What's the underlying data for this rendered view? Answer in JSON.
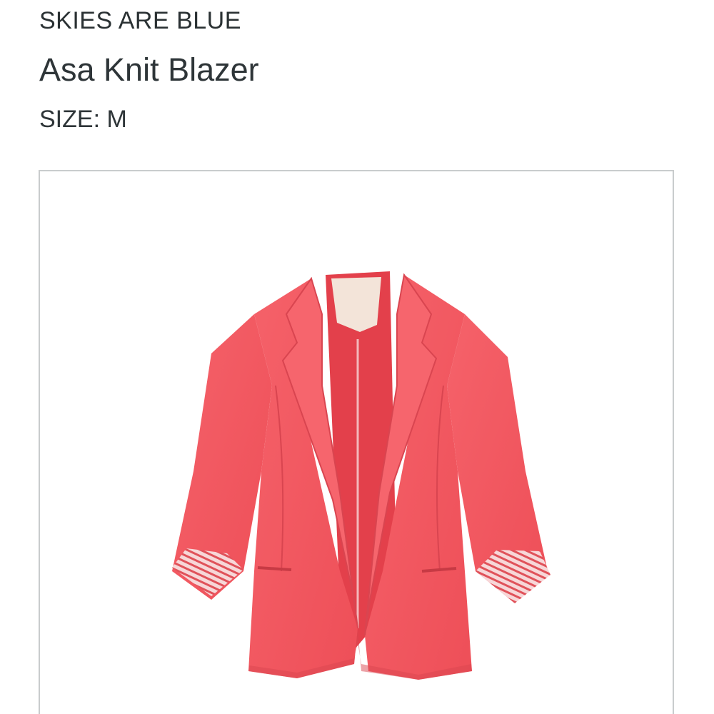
{
  "product": {
    "brand": "SKIES ARE BLUE",
    "name": "Asa Knit Blazer",
    "size_label": "SIZE:",
    "size_value": "M"
  },
  "image": {
    "subject": "coral pink knit blazer with rolled striped cuffs",
    "colors": {
      "blazer": "#f2575f",
      "blazer_shadow": "#d94550",
      "lining": "#e3404b",
      "cuff_stripe_light": "#f7d7d8",
      "cuff_stripe_dark": "#e0525a",
      "tag": "#f3e4d9",
      "frame_border": "#c9cccd"
    }
  }
}
